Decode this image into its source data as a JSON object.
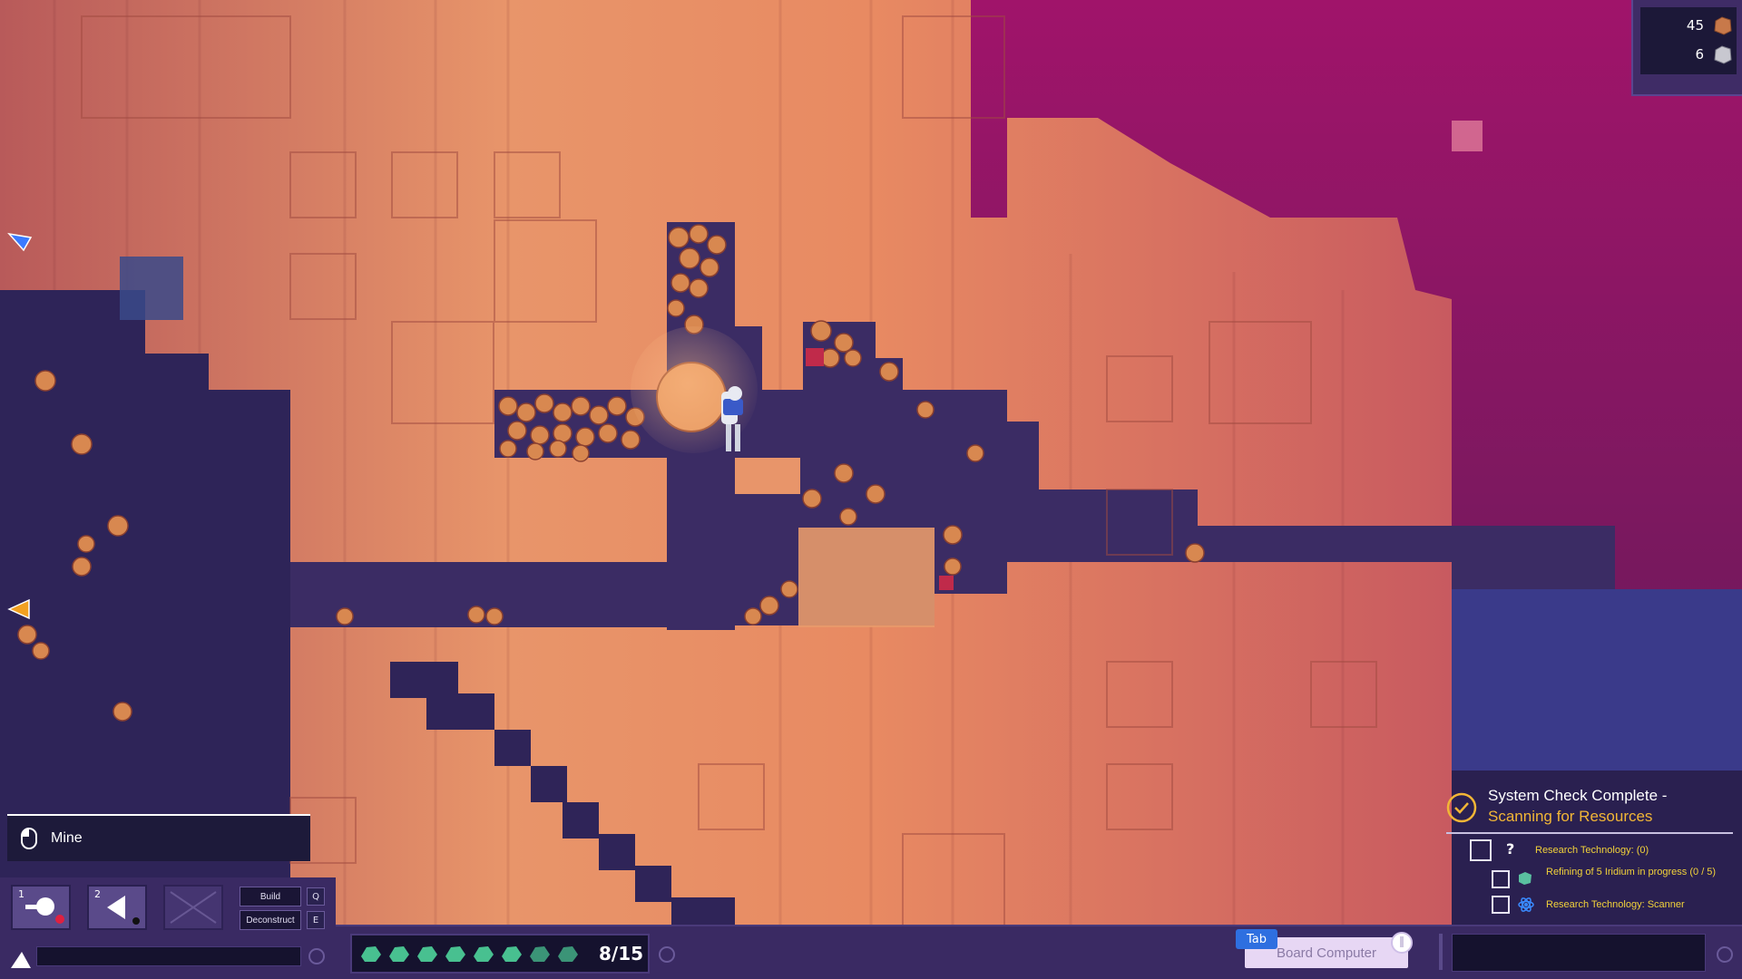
{
  "resources": [
    {
      "count": "45",
      "icon": "copper-ore-icon",
      "color": "#c8794a"
    },
    {
      "count": "6",
      "icon": "iron-ore-icon",
      "color": "#c8c8d0"
    }
  ],
  "action_hint": {
    "icon": "mouse-left-click-icon",
    "label": "Mine"
  },
  "toolbar": {
    "slots": [
      {
        "number": "1",
        "icon": "drill-tool-icon"
      },
      {
        "number": "2",
        "icon": "scanner-tool-icon"
      }
    ],
    "build_label": "Build",
    "build_key": "Q",
    "deconstruct_label": "Deconstruct",
    "deconstruct_key": "E"
  },
  "health": {
    "filled": 8,
    "total": 15,
    "text": "8/15",
    "color": "#48c090"
  },
  "board_computer": {
    "key": "Tab",
    "label": "Board Computer"
  },
  "objectives": {
    "title": "System Check Complete -",
    "subtitle": "Scanning for Resources",
    "items": [
      {
        "icon": "question-icon",
        "text": "Research Technology: (0)"
      },
      {
        "icon": "iridium-icon",
        "text": "Refining of 5 Iridium in progress (0 / 5)"
      },
      {
        "icon": "atom-icon",
        "text": "Research Technology: Scanner"
      }
    ]
  },
  "colors": {
    "rock": "#e08a5e",
    "tunnel": "#3a2c63",
    "magenta": "#a01a60",
    "hud_panel": "#3a2a63",
    "accent_yellow": "#f2b636"
  }
}
